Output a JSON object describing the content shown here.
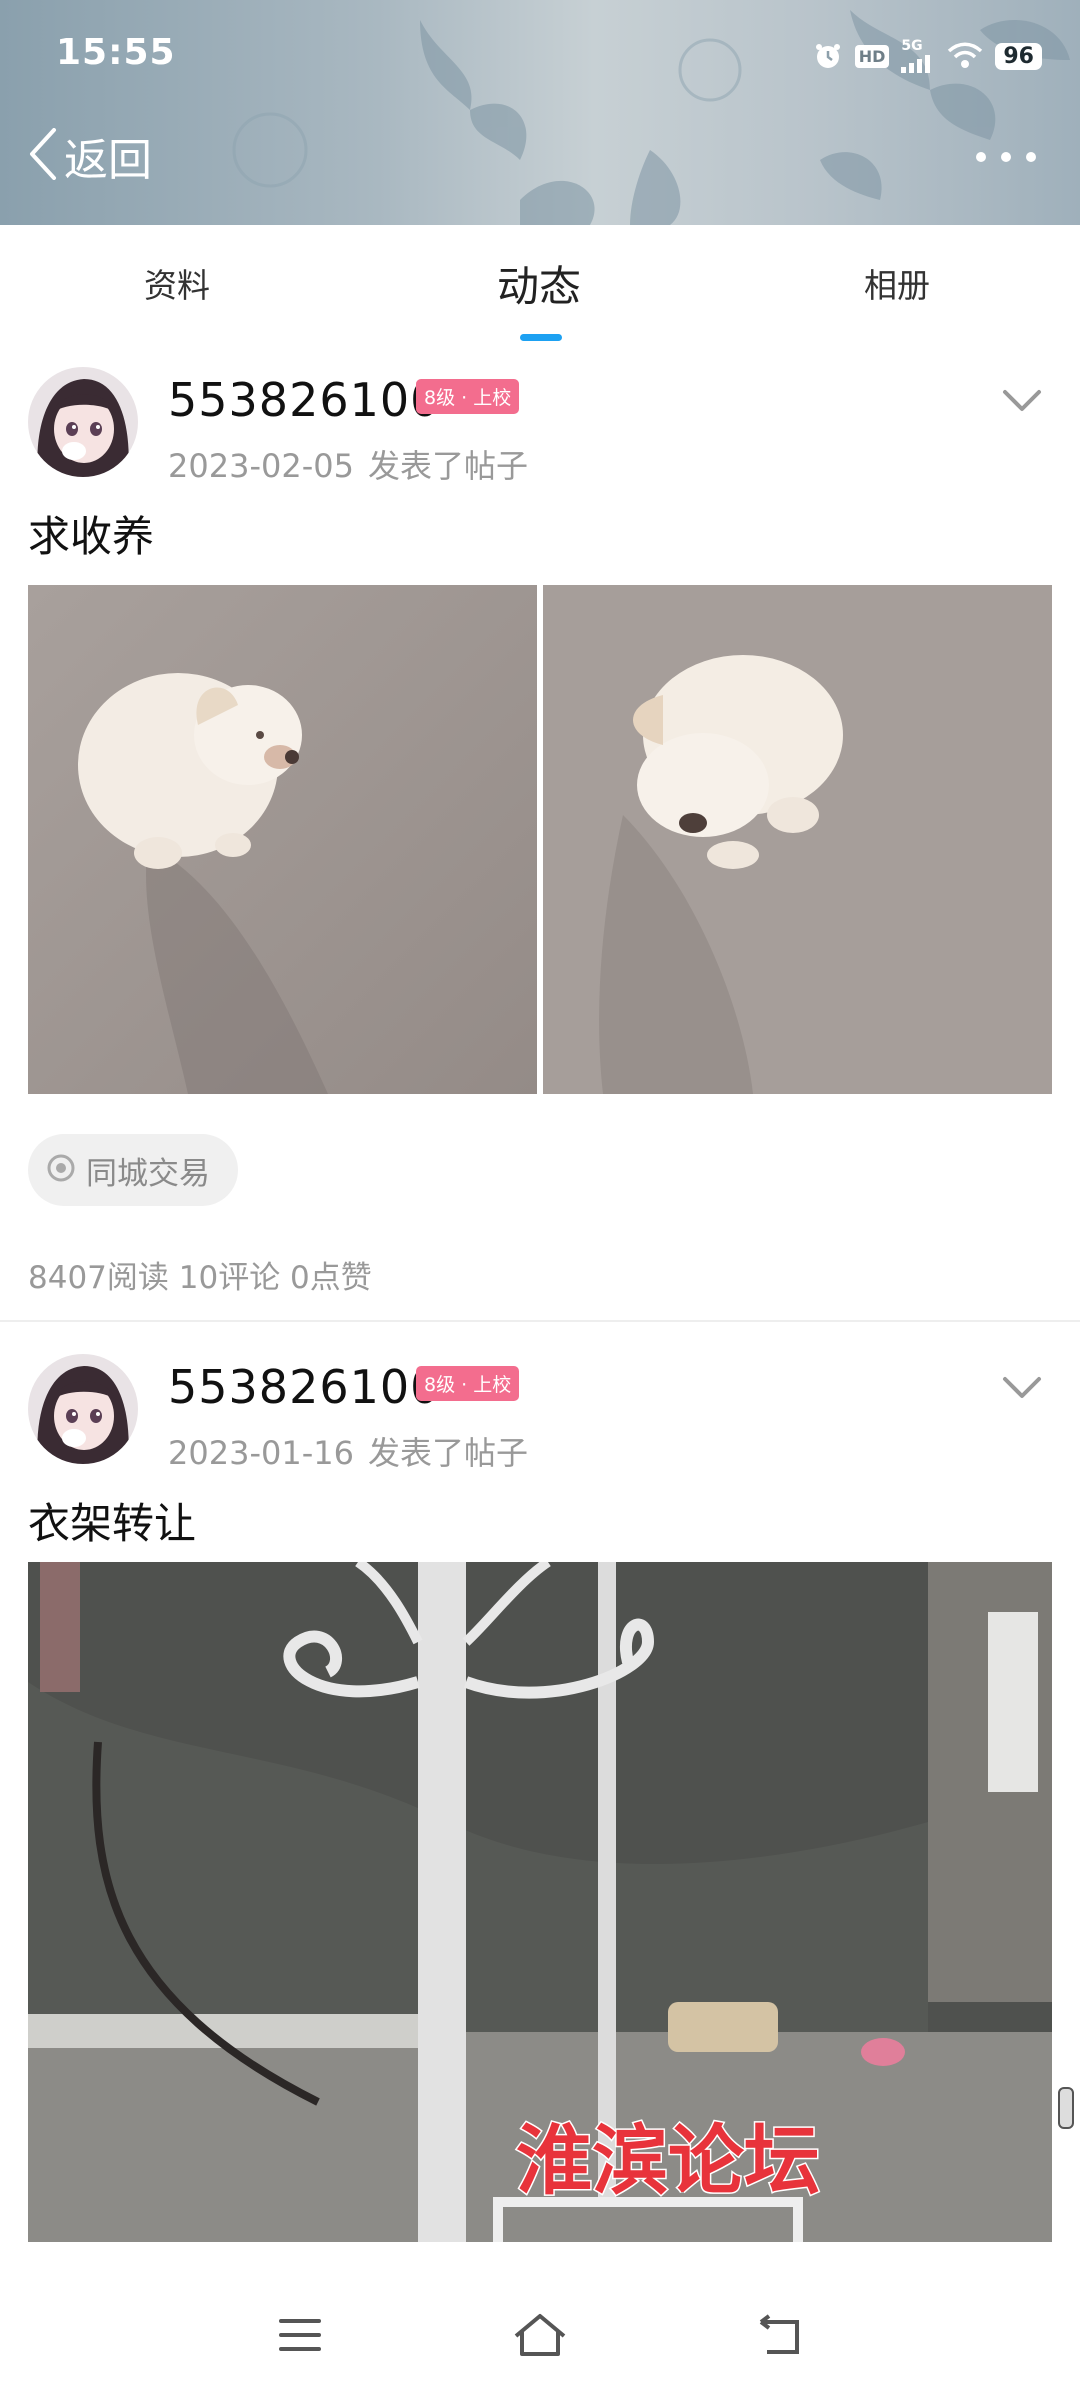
{
  "status_bar": {
    "time": "15:55",
    "network": "5G",
    "hd_label": "HD",
    "battery": "96"
  },
  "header": {
    "back_label": "返回",
    "background_color": "#9fb0bb"
  },
  "tabs": [
    {
      "label": "资料",
      "active": false
    },
    {
      "label": "动态",
      "active": true
    },
    {
      "label": "相册",
      "active": false
    }
  ],
  "accent_color": "#1da1f2",
  "posts": [
    {
      "username": "553826100",
      "level": "8级 · 上校",
      "date": "2023-02-05",
      "action": "发表了帖子",
      "title": "求收养",
      "tag": "同城交易",
      "stats": "8407阅读 10评论 0点赞"
    },
    {
      "username": "553826100",
      "level": "8级 · 上校",
      "date": "2023-01-16",
      "action": "发表了帖子",
      "title": "衣架转让",
      "watermark": "淮滨论坛"
    }
  ],
  "icons": {
    "back": "chevron-left-icon",
    "more": "more-dots-icon",
    "expand": "chevron-down-icon",
    "tag": "location-target-icon",
    "nav_menu": "menu-icon",
    "nav_home": "home-icon",
    "nav_back": "back-icon"
  }
}
